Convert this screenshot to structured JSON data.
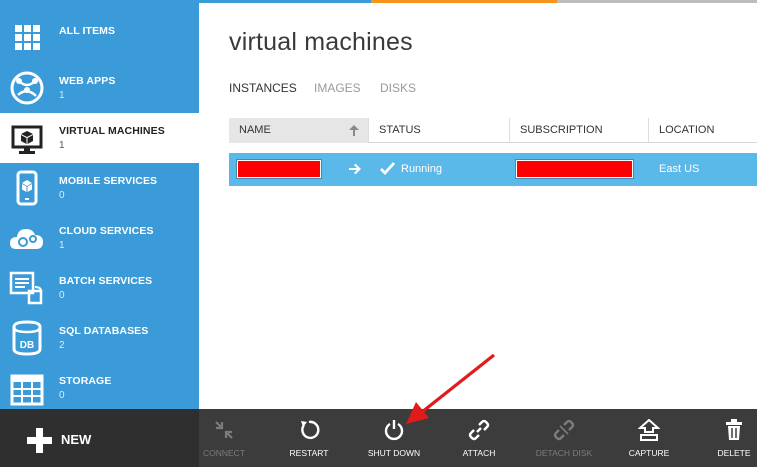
{
  "colors": {
    "sidebar": "#3a9bd8",
    "selected_row": "#5bb9e9",
    "command_bar": "#3c3c3c",
    "redaction": "#ff0000",
    "annotation_arrow": "#e01b1b"
  },
  "sidebar": {
    "items": [
      {
        "label": "ALL ITEMS",
        "count": "",
        "icon": "grid-icon",
        "active": false
      },
      {
        "label": "WEB APPS",
        "count": "1",
        "icon": "globe-icon",
        "active": false
      },
      {
        "label": "VIRTUAL MACHINES",
        "count": "1",
        "icon": "monitor-icon",
        "active": true
      },
      {
        "label": "MOBILE SERVICES",
        "count": "0",
        "icon": "phone-icon",
        "active": false
      },
      {
        "label": "CLOUD SERVICES",
        "count": "1",
        "icon": "cloud-gears-icon",
        "active": false
      },
      {
        "label": "BATCH SERVICES",
        "count": "0",
        "icon": "batch-icon",
        "active": false
      },
      {
        "label": "SQL DATABASES",
        "count": "2",
        "icon": "database-icon",
        "active": false
      },
      {
        "label": "STORAGE",
        "count": "0",
        "icon": "table-icon",
        "active": false
      }
    ]
  },
  "main": {
    "title": "virtual machines",
    "tabs": [
      {
        "label": "INSTANCES",
        "active": true
      },
      {
        "label": "IMAGES",
        "active": false
      },
      {
        "label": "DISKS",
        "active": false
      }
    ],
    "table": {
      "headers": [
        "NAME",
        "STATUS",
        "SUBSCRIPTION",
        "LOCATION"
      ],
      "rows": [
        {
          "name": "",
          "status": "Running",
          "subscription": "",
          "location": "East US"
        }
      ]
    }
  },
  "commandbar": {
    "new_label": "NEW",
    "commands": [
      {
        "label": "CONNECT",
        "icon": "connect-icon",
        "enabled": false
      },
      {
        "label": "RESTART",
        "icon": "restart-icon",
        "enabled": true
      },
      {
        "label": "SHUT DOWN",
        "icon": "power-icon",
        "enabled": true
      },
      {
        "label": "ATTACH",
        "icon": "link-icon",
        "enabled": true
      },
      {
        "label": "DETACH DISK",
        "icon": "detach-icon",
        "enabled": false
      },
      {
        "label": "CAPTURE",
        "icon": "capture-icon",
        "enabled": true
      },
      {
        "label": "DELETE",
        "icon": "trash-icon",
        "enabled": true
      }
    ]
  }
}
